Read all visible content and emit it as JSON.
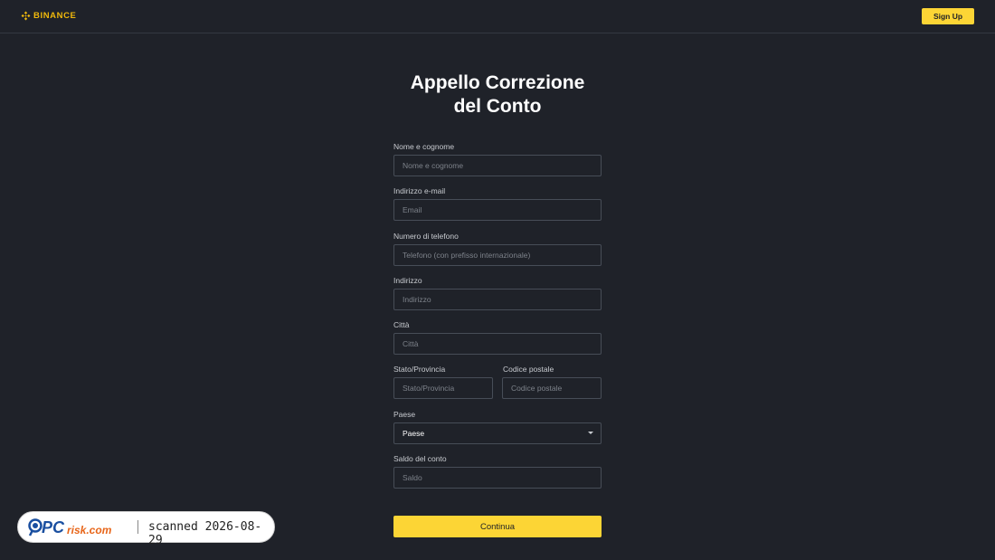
{
  "header": {
    "logo_text": "BINANCE",
    "signup_label": "Sign Up"
  },
  "page": {
    "title_line1": "Appello Correzione",
    "title_line2": "del Conto"
  },
  "form": {
    "name": {
      "label": "Nome e cognome",
      "placeholder": "Nome e cognome",
      "value": ""
    },
    "email": {
      "label": "Indirizzo e-mail",
      "placeholder": "Email",
      "value": ""
    },
    "phone": {
      "label": "Numero di telefono",
      "placeholder": "Telefono (con prefisso internazionale)",
      "value": ""
    },
    "address": {
      "label": "Indirizzo",
      "placeholder": "Indirizzo",
      "value": ""
    },
    "city": {
      "label": "Città",
      "placeholder": "Città",
      "value": ""
    },
    "state": {
      "label": "Stato/Provincia",
      "placeholder": "Stato/Provincia",
      "value": ""
    },
    "postal": {
      "label": "Codice postale",
      "placeholder": "Codice postale",
      "value": ""
    },
    "country": {
      "label": "Paese",
      "selected": "Paese"
    },
    "balance": {
      "label": "Saldo del conto",
      "placeholder": "Saldo",
      "value": ""
    },
    "submit_label": "Continua"
  },
  "watermark": {
    "logo_text": "PCrisk.com",
    "scan_text": "scanned 2026-08-29"
  },
  "colors": {
    "background": "#1f2229",
    "accent": "#fcd535",
    "brand": "#f0b90b",
    "field_border": "#474d57"
  }
}
